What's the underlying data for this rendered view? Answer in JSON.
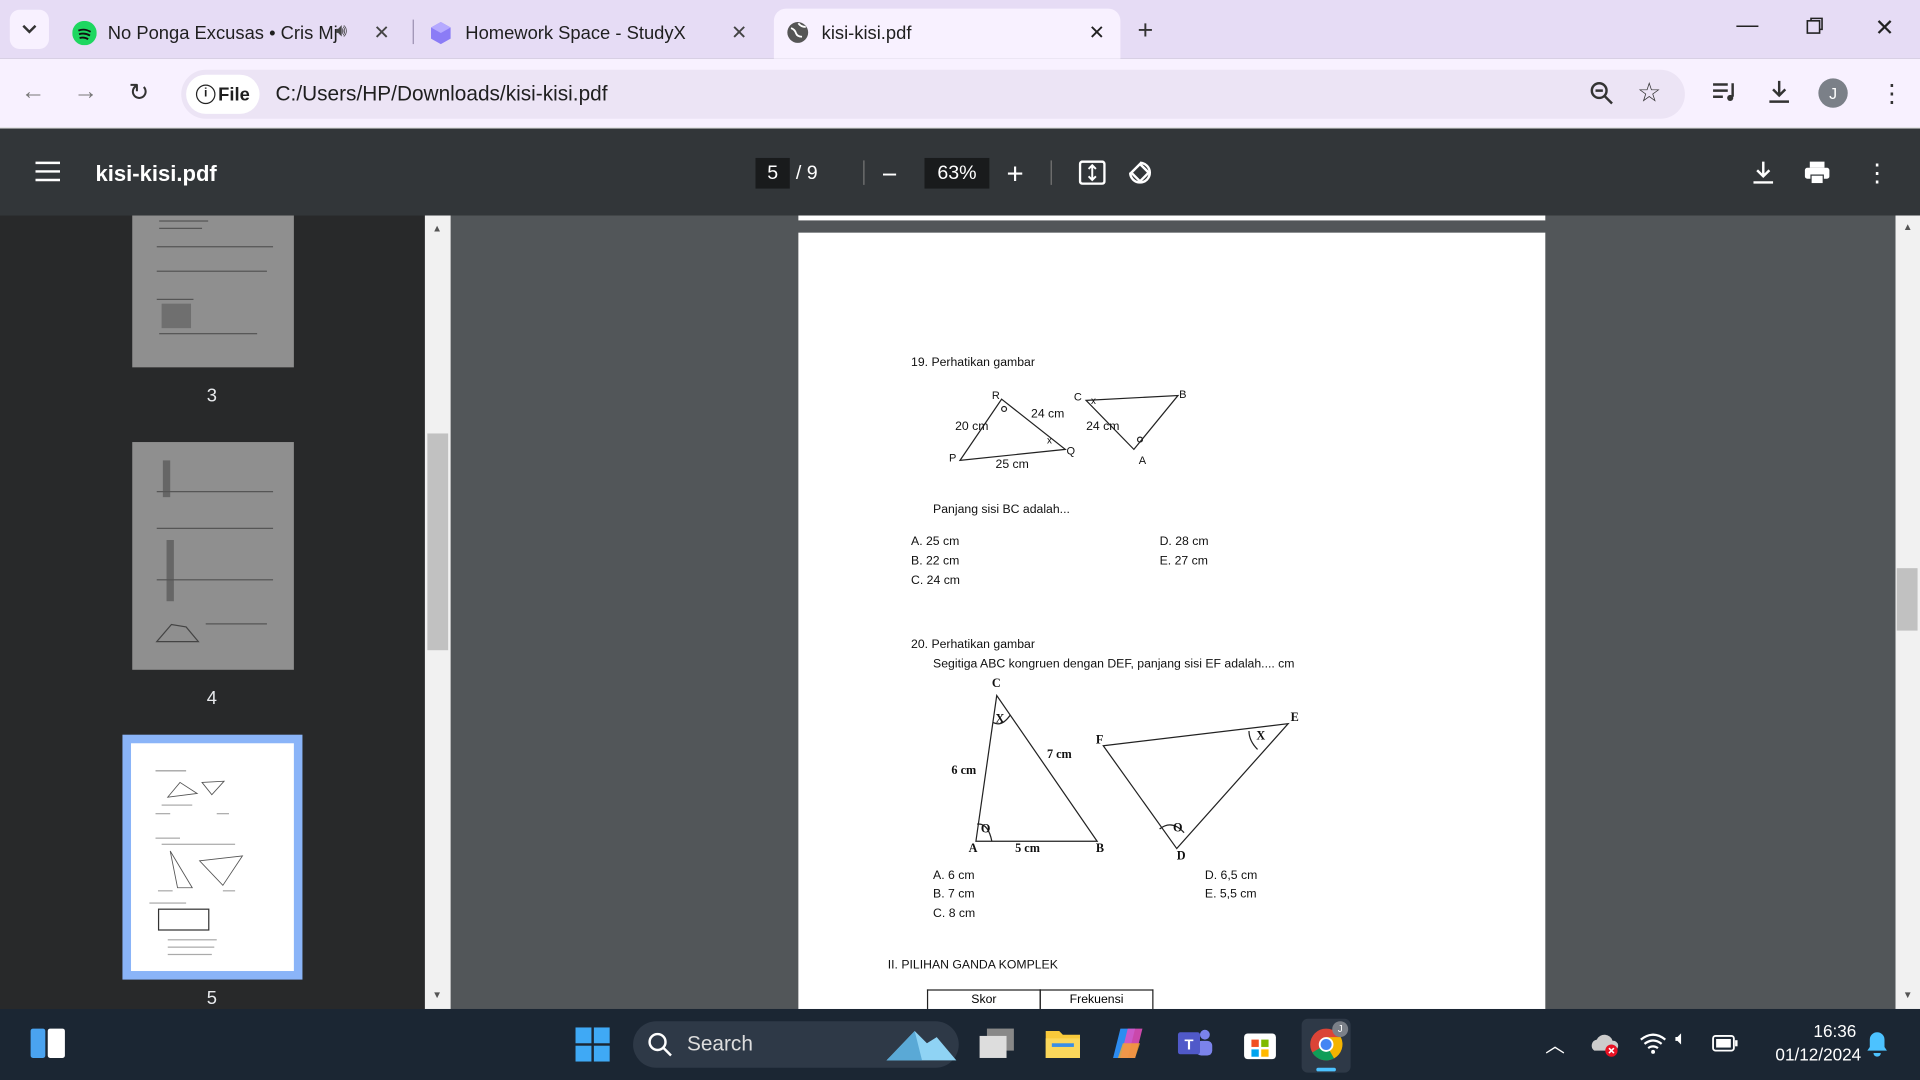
{
  "browser": {
    "tabs": [
      {
        "title": "No Ponga Excusas • Cris Mj",
        "icon": "spotify-icon",
        "audio": true
      },
      {
        "title": "Homework Space - StudyX",
        "icon": "studyx-icon"
      },
      {
        "title": "kisi-kisi.pdf",
        "icon": "globe-icon",
        "active": true
      }
    ],
    "omnibox": {
      "chip": "File",
      "url": "C:/Users/HP/Downloads/kisi-kisi.pdf"
    },
    "avatar": "J"
  },
  "viewer": {
    "title": "kisi-kisi.pdf",
    "page": "5",
    "total": "/ 9",
    "zoom": "63%",
    "thumbnails": [
      "3",
      "4",
      "5"
    ],
    "selected_thumbnail": "5"
  },
  "document": {
    "q19": {
      "title": "19.  Perhatikan gambar",
      "question": "Panjang sisi BC adalah...",
      "labels": {
        "R": "R",
        "P": "P",
        "Q": "Q",
        "C": "C",
        "B": "B",
        "A": "A",
        "pr": "20 cm",
        "rq": "24 cm",
        "pq": "25 cm",
        "ca": "24 cm",
        "x": "x",
        "o": "o"
      },
      "options": [
        "A.   25 cm",
        "B.   22 cm",
        "C.   24 cm",
        "D. 28 cm",
        "E. 27 cm"
      ]
    },
    "q20": {
      "title": "20.  Perhatikan gambar",
      "subtitle": "Segitiga ABC kongruen dengan DEF, panjang sisi EF adalah.... cm",
      "labels": {
        "C": "C",
        "A": "A",
        "B": "B",
        "E": "E",
        "F": "F",
        "D": "D",
        "ac": "6 cm",
        "cb": "7 cm",
        "ab": "5 cm",
        "x": "X",
        "o": "O"
      },
      "options": [
        "A.   6     cm",
        "B.   7     cm",
        "C.   8 cm",
        "D. 6,5 cm",
        "E. 5,5 cm"
      ]
    },
    "section": "II. PILIHAN GANDA KOMPLEK",
    "table_headers": [
      "Skor",
      "Frekuensi"
    ]
  },
  "taskbar": {
    "search": "Search",
    "time": "16:36",
    "date": "01/12/2024"
  },
  "colors": {
    "accent": "#8ab4f8",
    "tabbar": "#e6dcf5",
    "pdf_toolbar": "#323639"
  }
}
